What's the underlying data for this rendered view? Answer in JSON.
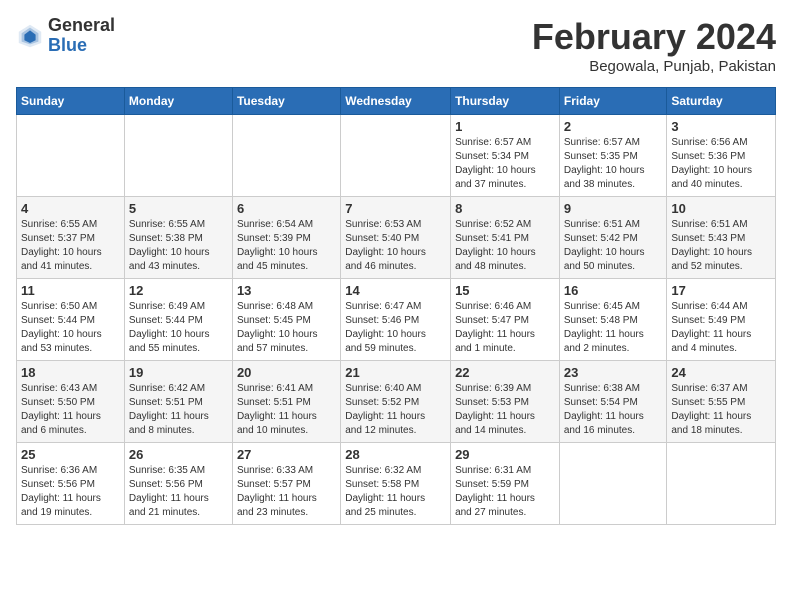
{
  "logo": {
    "general": "General",
    "blue": "Blue"
  },
  "title": "February 2024",
  "location": "Begowala, Punjab, Pakistan",
  "days_header": [
    "Sunday",
    "Monday",
    "Tuesday",
    "Wednesday",
    "Thursday",
    "Friday",
    "Saturday"
  ],
  "weeks": [
    [
      {
        "day": "",
        "info": ""
      },
      {
        "day": "",
        "info": ""
      },
      {
        "day": "",
        "info": ""
      },
      {
        "day": "",
        "info": ""
      },
      {
        "day": "1",
        "info": "Sunrise: 6:57 AM\nSunset: 5:34 PM\nDaylight: 10 hours\nand 37 minutes."
      },
      {
        "day": "2",
        "info": "Sunrise: 6:57 AM\nSunset: 5:35 PM\nDaylight: 10 hours\nand 38 minutes."
      },
      {
        "day": "3",
        "info": "Sunrise: 6:56 AM\nSunset: 5:36 PM\nDaylight: 10 hours\nand 40 minutes."
      }
    ],
    [
      {
        "day": "4",
        "info": "Sunrise: 6:55 AM\nSunset: 5:37 PM\nDaylight: 10 hours\nand 41 minutes."
      },
      {
        "day": "5",
        "info": "Sunrise: 6:55 AM\nSunset: 5:38 PM\nDaylight: 10 hours\nand 43 minutes."
      },
      {
        "day": "6",
        "info": "Sunrise: 6:54 AM\nSunset: 5:39 PM\nDaylight: 10 hours\nand 45 minutes."
      },
      {
        "day": "7",
        "info": "Sunrise: 6:53 AM\nSunset: 5:40 PM\nDaylight: 10 hours\nand 46 minutes."
      },
      {
        "day": "8",
        "info": "Sunrise: 6:52 AM\nSunset: 5:41 PM\nDaylight: 10 hours\nand 48 minutes."
      },
      {
        "day": "9",
        "info": "Sunrise: 6:51 AM\nSunset: 5:42 PM\nDaylight: 10 hours\nand 50 minutes."
      },
      {
        "day": "10",
        "info": "Sunrise: 6:51 AM\nSunset: 5:43 PM\nDaylight: 10 hours\nand 52 minutes."
      }
    ],
    [
      {
        "day": "11",
        "info": "Sunrise: 6:50 AM\nSunset: 5:44 PM\nDaylight: 10 hours\nand 53 minutes."
      },
      {
        "day": "12",
        "info": "Sunrise: 6:49 AM\nSunset: 5:44 PM\nDaylight: 10 hours\nand 55 minutes."
      },
      {
        "day": "13",
        "info": "Sunrise: 6:48 AM\nSunset: 5:45 PM\nDaylight: 10 hours\nand 57 minutes."
      },
      {
        "day": "14",
        "info": "Sunrise: 6:47 AM\nSunset: 5:46 PM\nDaylight: 10 hours\nand 59 minutes."
      },
      {
        "day": "15",
        "info": "Sunrise: 6:46 AM\nSunset: 5:47 PM\nDaylight: 11 hours\nand 1 minute."
      },
      {
        "day": "16",
        "info": "Sunrise: 6:45 AM\nSunset: 5:48 PM\nDaylight: 11 hours\nand 2 minutes."
      },
      {
        "day": "17",
        "info": "Sunrise: 6:44 AM\nSunset: 5:49 PM\nDaylight: 11 hours\nand 4 minutes."
      }
    ],
    [
      {
        "day": "18",
        "info": "Sunrise: 6:43 AM\nSunset: 5:50 PM\nDaylight: 11 hours\nand 6 minutes."
      },
      {
        "day": "19",
        "info": "Sunrise: 6:42 AM\nSunset: 5:51 PM\nDaylight: 11 hours\nand 8 minutes."
      },
      {
        "day": "20",
        "info": "Sunrise: 6:41 AM\nSunset: 5:51 PM\nDaylight: 11 hours\nand 10 minutes."
      },
      {
        "day": "21",
        "info": "Sunrise: 6:40 AM\nSunset: 5:52 PM\nDaylight: 11 hours\nand 12 minutes."
      },
      {
        "day": "22",
        "info": "Sunrise: 6:39 AM\nSunset: 5:53 PM\nDaylight: 11 hours\nand 14 minutes."
      },
      {
        "day": "23",
        "info": "Sunrise: 6:38 AM\nSunset: 5:54 PM\nDaylight: 11 hours\nand 16 minutes."
      },
      {
        "day": "24",
        "info": "Sunrise: 6:37 AM\nSunset: 5:55 PM\nDaylight: 11 hours\nand 18 minutes."
      }
    ],
    [
      {
        "day": "25",
        "info": "Sunrise: 6:36 AM\nSunset: 5:56 PM\nDaylight: 11 hours\nand 19 minutes."
      },
      {
        "day": "26",
        "info": "Sunrise: 6:35 AM\nSunset: 5:56 PM\nDaylight: 11 hours\nand 21 minutes."
      },
      {
        "day": "27",
        "info": "Sunrise: 6:33 AM\nSunset: 5:57 PM\nDaylight: 11 hours\nand 23 minutes."
      },
      {
        "day": "28",
        "info": "Sunrise: 6:32 AM\nSunset: 5:58 PM\nDaylight: 11 hours\nand 25 minutes."
      },
      {
        "day": "29",
        "info": "Sunrise: 6:31 AM\nSunset: 5:59 PM\nDaylight: 11 hours\nand 27 minutes."
      },
      {
        "day": "",
        "info": ""
      },
      {
        "day": "",
        "info": ""
      }
    ]
  ]
}
